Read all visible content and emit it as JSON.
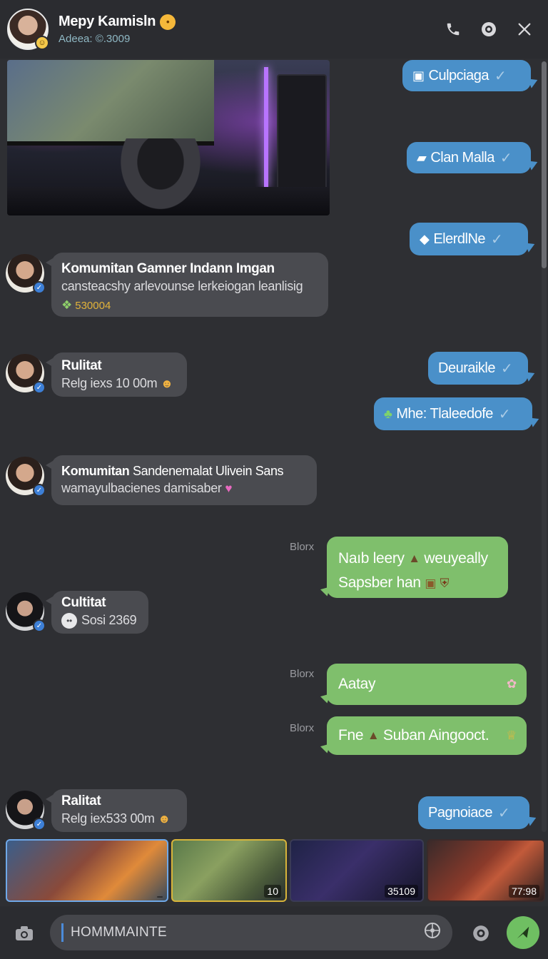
{
  "header": {
    "name": "Mepy Kaımisln",
    "status": "Adeea: ©.3009",
    "icons": [
      "phone-icon",
      "emoji-icon",
      "close-icon"
    ]
  },
  "incoming": [
    {
      "title": "Komumitan Gamner Indann Imgan",
      "text": "cansteacshy arlevounse lerkeiogan leanlisig",
      "meta": "530004"
    },
    {
      "title": "Rulitat",
      "text": "Relg iexs 10 00m"
    },
    {
      "title": "Komumitan",
      "title_rest": "Sandenemalat Ulivein Sans",
      "text": "wamayulbacienes damisaber"
    },
    {
      "title": "Cultitat",
      "text": "Sosi 2369"
    },
    {
      "title": "Ralitat",
      "text": "Relg iex533 00m"
    }
  ],
  "outgoing_blue": [
    {
      "text": "Culpciaga"
    },
    {
      "text": "Clan Malla"
    },
    {
      "text": "ElerdlNe"
    },
    {
      "text": "Deuraikle"
    },
    {
      "text": "Mhe: Tlaleedofe"
    },
    {
      "text": "Pagnoiace"
    }
  ],
  "outgoing_green": [
    {
      "label": "Blorx",
      "line1": "Naıb leery",
      "line1b": "weuyeally",
      "line2": "Sapsber han"
    },
    {
      "label": "Blorx",
      "text": "Aatay"
    },
    {
      "label": "Blorx",
      "text": "Fne",
      "text_b": "Suban Aingooct."
    }
  ],
  "thumbnails": [
    {
      "count": ""
    },
    {
      "count": "10"
    },
    {
      "count": "35109"
    },
    {
      "count": "77:98"
    }
  ],
  "composer": {
    "input_value": "HOMMMAINTE"
  },
  "colors": {
    "bubble_blue": "#4a90c9",
    "bubble_green": "#7fbf6c",
    "bubble_incoming": "#4a4b50",
    "background": "#2e2f33"
  }
}
